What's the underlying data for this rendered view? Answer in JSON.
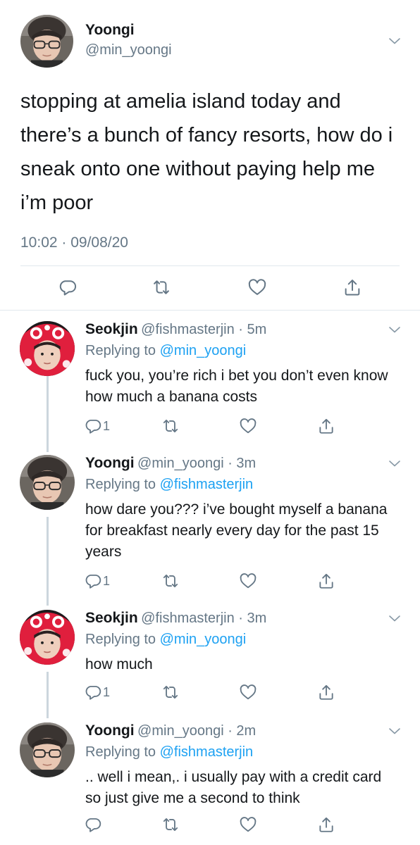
{
  "main_tweet": {
    "name": "Yoongi",
    "handle": "@min_yoongi",
    "text": "stopping at amelia island today and there’s a bunch of fancy resorts, how do i sneak onto one without paying help me i’m poor",
    "timestamp": "10:02 · 09/08/20",
    "actions": [
      "reply-icon",
      "retweet-icon",
      "like-icon",
      "share-icon"
    ]
  },
  "replies": [
    {
      "name": "Seokjin",
      "handle": "@fishmasterjin",
      "age": "5m",
      "replying_prefix": "Replying to ",
      "replying_to": "@min_yoongi",
      "text": "fuck you, you’re rich i bet you don’t even know how much a banana costs",
      "reply_count": "1"
    },
    {
      "name": "Yoongi",
      "handle": "@min_yoongi",
      "age": "3m",
      "replying_prefix": "Replying to ",
      "replying_to": "@fishmasterjin",
      "text": "how dare you??? i’ve bought myself a banana for breakfast nearly every day for the past 15 years",
      "reply_count": "1"
    },
    {
      "name": "Seokjin",
      "handle": "@fishmasterjin",
      "age": "3m",
      "replying_prefix": "Replying to ",
      "replying_to": "@min_yoongi",
      "text": "how much",
      "reply_count": "1"
    },
    {
      "name": "Yoongi",
      "handle": "@min_yoongi",
      "age": "2m",
      "replying_prefix": "Replying to ",
      "replying_to": "@fishmasterjin",
      "text": ".. well i mean,. i usually pay with a credit card so just give me a second to think",
      "reply_count": ""
    }
  ],
  "separator": " · "
}
